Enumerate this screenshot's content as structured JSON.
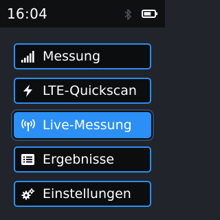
{
  "status_bar": {
    "time": "16:04",
    "bluetooth_icon": "bluetooth-icon",
    "battery_icon": "battery-icon",
    "battery_level": 0.7
  },
  "colors": {
    "accent": "#2b8ff5",
    "background": "#21242a",
    "status_bar": "#0f1012",
    "item_background": "#0c0d0f",
    "text": "#ffffff"
  },
  "menu": {
    "selected_index": 2,
    "items": [
      {
        "label": "Messung",
        "icon": "signal-bars-icon"
      },
      {
        "label": "LTE-Quickscan",
        "icon": "lightning-icon"
      },
      {
        "label": "Live-Messung",
        "icon": "antenna-broadcast-icon"
      },
      {
        "label": "Ergebnisse",
        "icon": "list-icon"
      },
      {
        "label": "Einstellungen",
        "icon": "gears-icon"
      }
    ]
  }
}
